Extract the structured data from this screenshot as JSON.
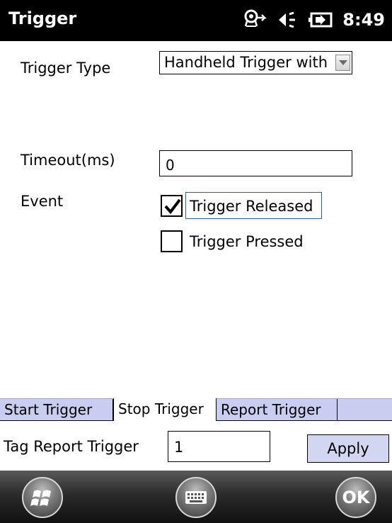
{
  "window": {
    "title": "Trigger",
    "clock": "8:49"
  },
  "status_icons": [
    "connectivity-icon",
    "volume-icon",
    "battery-icon"
  ],
  "form": {
    "trigger_type_label": "Trigger Type",
    "trigger_type_value": "Handheld Trigger with",
    "timeout_label": "Timeout(ms)",
    "timeout_value": "0",
    "event_label": "Event",
    "events": [
      {
        "label": "Trigger Released",
        "checked": true
      },
      {
        "label": "Trigger Pressed",
        "checked": false
      }
    ]
  },
  "tabs": [
    {
      "label": "Start Trigger",
      "active": false
    },
    {
      "label": "Stop Trigger",
      "active": true
    },
    {
      "label": "Report Trigger",
      "active": false
    }
  ],
  "footer": {
    "tag_report_label": "Tag Report Trigger",
    "tag_report_value": "1",
    "apply_label": "Apply"
  },
  "softkeys": {
    "left": "windows-start-icon",
    "center": "keyboard-icon",
    "right_label": "OK"
  },
  "colors": {
    "title_bar": "#000000",
    "tab_strip": "#c9cdef",
    "apply_button": "#d2d6f0",
    "focus_border": "#2d5f9a"
  }
}
